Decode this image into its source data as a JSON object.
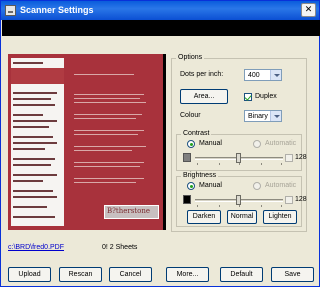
{
  "window": {
    "title": "Scanner Settings",
    "close_glyph": "✕"
  },
  "preview": {
    "file_link": "c:\\BRD\\fred0.PDF",
    "sheets_label": "0! 2   Sheets",
    "logo_text": "B?therstone"
  },
  "options": {
    "legend": "Options",
    "dpi_label": "Dots per inch:",
    "dpi_value": "400",
    "area_button": "Area...",
    "duplex_label": "Duplex",
    "duplex_checked": true,
    "colour_label": "Colour",
    "colour_value": "Binary"
  },
  "contrast": {
    "legend": "Contrast",
    "manual_label": "Manual",
    "automatic_label": "Automatic",
    "value": "128",
    "swatch_color": "#808080"
  },
  "brightness": {
    "legend": "Brightness",
    "manual_label": "Manual",
    "automatic_label": "Automatic",
    "value": "128",
    "swatch_color": "#000000",
    "darken_button": "Darken",
    "normal_button": "Normal",
    "lighten_button": "Lighten"
  },
  "footer": {
    "upload": "Upload",
    "rescan": "Rescan",
    "cancel": "Cancel",
    "more": "More...",
    "default": "Default",
    "save": "Save"
  }
}
